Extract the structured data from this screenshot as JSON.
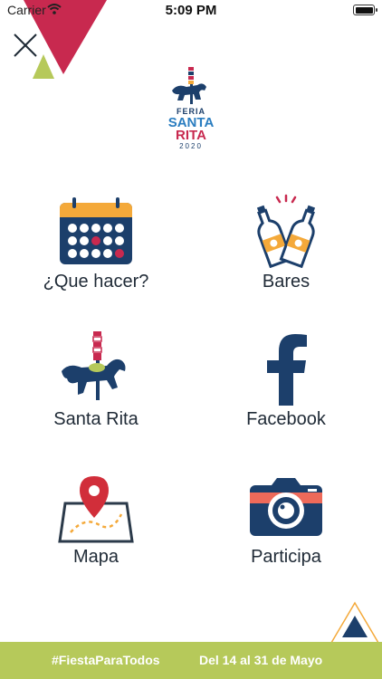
{
  "status_bar": {
    "carrier": "Carrier",
    "time": "5:09 PM"
  },
  "logo": {
    "line1": "FERIA",
    "line2": "SANTA",
    "line3": "RITA",
    "line4": "2020"
  },
  "menu": {
    "items": [
      {
        "label": "¿Que hacer?",
        "icon": "calendar-icon"
      },
      {
        "label": "Bares",
        "icon": "beer-bottles-icon"
      },
      {
        "label": "Santa Rita",
        "icon": "carousel-horse-icon"
      },
      {
        "label": "Facebook",
        "icon": "facebook-icon"
      },
      {
        "label": "Mapa",
        "icon": "map-pin-icon"
      },
      {
        "label": "Participa",
        "icon": "camera-icon"
      }
    ]
  },
  "footer": {
    "hashtag": "#FiestaParaTodos",
    "dates": "Del 14 al 31 de Mayo"
  },
  "colors": {
    "navy": "#1c3f6b",
    "crimson": "#c8294f",
    "lime": "#b6c95a",
    "orange": "#f4a93a",
    "coral": "#ee6a5a"
  }
}
